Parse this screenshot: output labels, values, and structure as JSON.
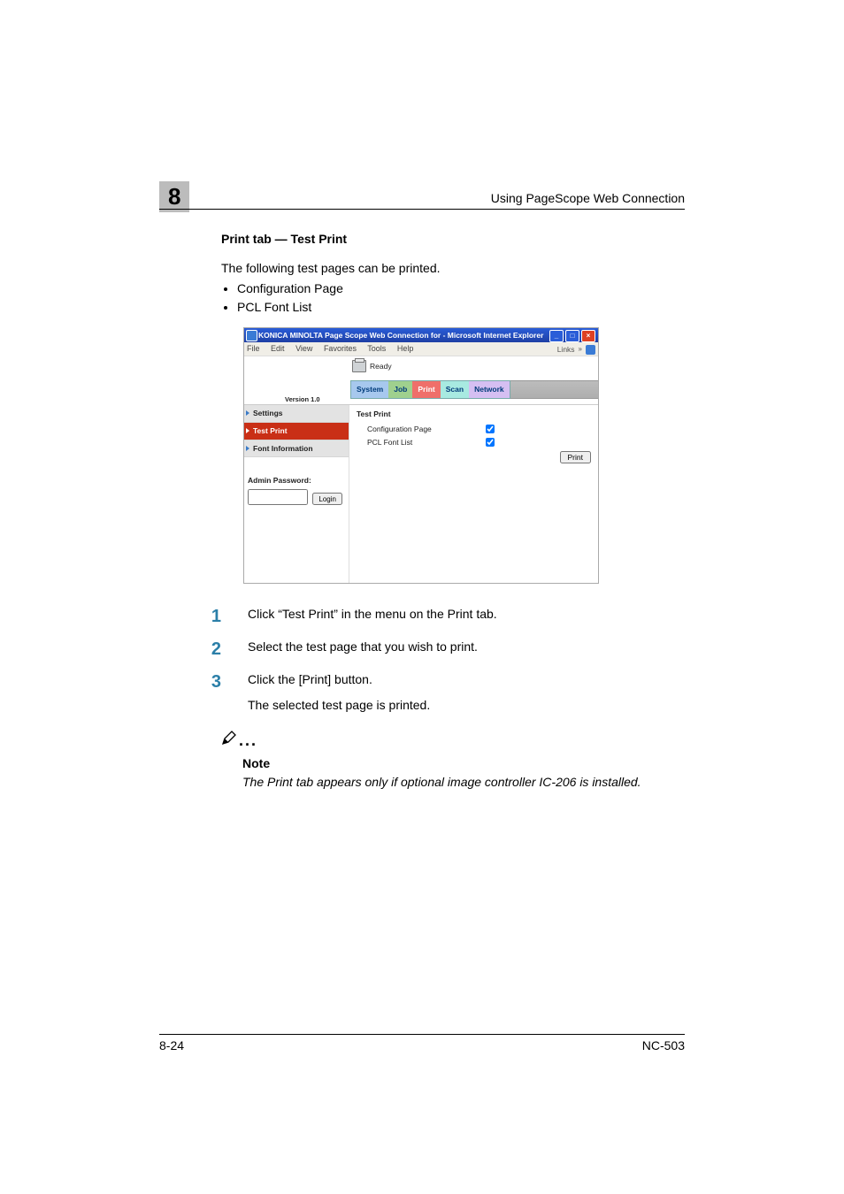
{
  "header": {
    "chapter_number": "8",
    "section_title": "Using PageScope Web Connection"
  },
  "section": {
    "title": "Print tab — Test Print",
    "intro": "The following test pages can be printed.",
    "bullets": [
      "Configuration Page",
      "PCL Font List"
    ]
  },
  "screenshot": {
    "window_title": "KONICA MINOLTA Page Scope Web Connection for      - Microsoft Internet Explorer",
    "menubar": {
      "file": "File",
      "edit": "Edit",
      "view": "View",
      "favorites": "Favorites",
      "tools": "Tools",
      "help": "Help"
    },
    "links_label": "Links",
    "version": "Version 1.0",
    "status": "Ready",
    "tabs": {
      "system": "System",
      "job": "Job",
      "print": "Print",
      "scan": "Scan",
      "network": "Network"
    },
    "sidebar": {
      "settings": "Settings",
      "test_print": "Test Print",
      "font_info": "Font Information",
      "admin_label": "Admin Password:",
      "login_btn": "Login"
    },
    "main": {
      "title": "Test Print",
      "row1_label": "Configuration Page",
      "row2_label": "PCL Font List",
      "print_btn": "Print"
    }
  },
  "steps": [
    {
      "num": "1",
      "text": "Click “Test Print” in the menu on the Print tab."
    },
    {
      "num": "2",
      "text": "Select the test page that you wish to print."
    },
    {
      "num": "3",
      "text": "Click the [Print] button.",
      "text2": "The selected test page is printed."
    }
  ],
  "note": {
    "heading": "Note",
    "body": "The Print tab appears only if optional image controller IC-206 is installed."
  },
  "footer": {
    "left": "8-24",
    "right": "NC-503"
  }
}
